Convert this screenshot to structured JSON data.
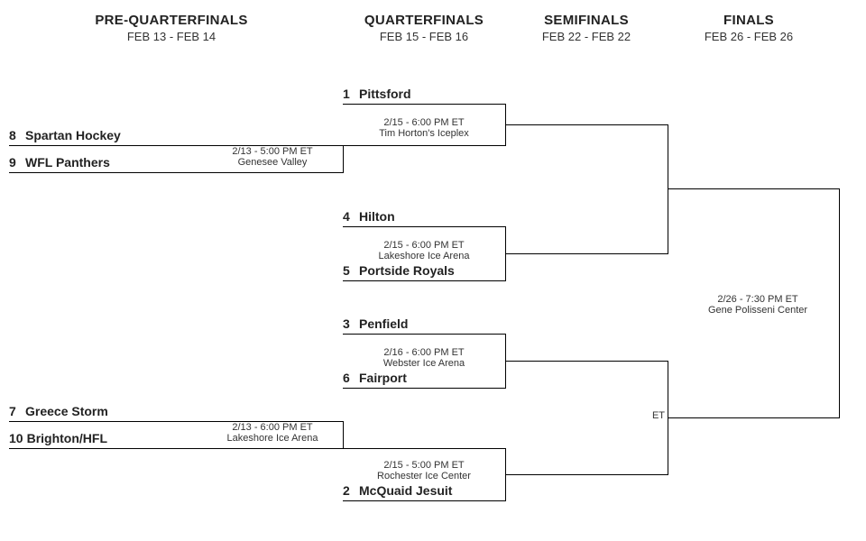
{
  "rounds": {
    "pq": {
      "title": "PRE-QUARTERFINALS",
      "dates": "FEB 13 - FEB 14"
    },
    "qf": {
      "title": "QUARTERFINALS",
      "dates": "FEB 15 - FEB 16"
    },
    "sf": {
      "title": "SEMIFINALS",
      "dates": "FEB 22 - FEB 22"
    },
    "f": {
      "title": "FINALS",
      "dates": "FEB 26 - FEB 26"
    }
  },
  "pq1": {
    "top": {
      "seed": "8",
      "name": "Spartan Hockey"
    },
    "bot": {
      "seed": "9",
      "name": "WFL Panthers"
    },
    "time": "2/13 - 5:00 PM ET",
    "venue": "Genesee Valley"
  },
  "pq2": {
    "top": {
      "seed": "7",
      "name": "Greece Storm"
    },
    "bot": {
      "seed": "10",
      "name": "Brighton/HFL"
    },
    "time": "2/13 - 6:00 PM ET",
    "venue": "Lakeshore Ice Arena"
  },
  "qf1": {
    "top": {
      "seed": "1",
      "name": "Pittsford"
    },
    "time": "2/15 - 6:00 PM ET",
    "venue": "Tim Horton's Iceplex"
  },
  "qf2": {
    "top": {
      "seed": "4",
      "name": "Hilton"
    },
    "bot": {
      "seed": "5",
      "name": "Portside Royals"
    },
    "time": "2/15 - 6:00 PM ET",
    "venue": "Lakeshore Ice Arena"
  },
  "qf3": {
    "top": {
      "seed": "3",
      "name": "Penfield"
    },
    "bot": {
      "seed": "6",
      "name": "Fairport"
    },
    "time": "2/16 - 6:00 PM ET",
    "venue": "Webster Ice Arena"
  },
  "qf4": {
    "bot": {
      "seed": "2",
      "name": "McQuaid Jesuit"
    },
    "time": "2/15 - 5:00 PM ET",
    "venue": "Rochester Ice Center"
  },
  "sf2": {
    "time": "ET"
  },
  "final": {
    "time": "2/26 - 7:30 PM ET",
    "venue": "Gene Polisseni Center"
  }
}
